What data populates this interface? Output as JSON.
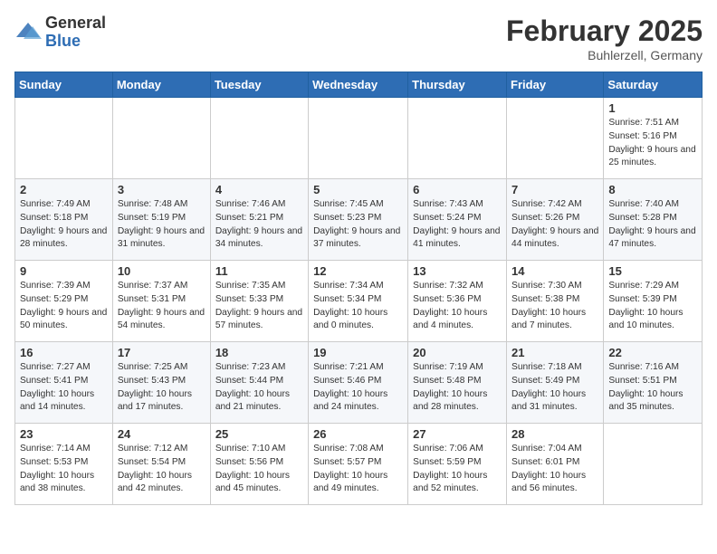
{
  "header": {
    "logo_general": "General",
    "logo_blue": "Blue",
    "month_title": "February 2025",
    "location": "Buhlerzell, Germany"
  },
  "weekdays": [
    "Sunday",
    "Monday",
    "Tuesday",
    "Wednesday",
    "Thursday",
    "Friday",
    "Saturday"
  ],
  "weeks": [
    [
      {
        "day": "",
        "info": ""
      },
      {
        "day": "",
        "info": ""
      },
      {
        "day": "",
        "info": ""
      },
      {
        "day": "",
        "info": ""
      },
      {
        "day": "",
        "info": ""
      },
      {
        "day": "",
        "info": ""
      },
      {
        "day": "1",
        "info": "Sunrise: 7:51 AM\nSunset: 5:16 PM\nDaylight: 9 hours and 25 minutes."
      }
    ],
    [
      {
        "day": "2",
        "info": "Sunrise: 7:49 AM\nSunset: 5:18 PM\nDaylight: 9 hours and 28 minutes."
      },
      {
        "day": "3",
        "info": "Sunrise: 7:48 AM\nSunset: 5:19 PM\nDaylight: 9 hours and 31 minutes."
      },
      {
        "day": "4",
        "info": "Sunrise: 7:46 AM\nSunset: 5:21 PM\nDaylight: 9 hours and 34 minutes."
      },
      {
        "day": "5",
        "info": "Sunrise: 7:45 AM\nSunset: 5:23 PM\nDaylight: 9 hours and 37 minutes."
      },
      {
        "day": "6",
        "info": "Sunrise: 7:43 AM\nSunset: 5:24 PM\nDaylight: 9 hours and 41 minutes."
      },
      {
        "day": "7",
        "info": "Sunrise: 7:42 AM\nSunset: 5:26 PM\nDaylight: 9 hours and 44 minutes."
      },
      {
        "day": "8",
        "info": "Sunrise: 7:40 AM\nSunset: 5:28 PM\nDaylight: 9 hours and 47 minutes."
      }
    ],
    [
      {
        "day": "9",
        "info": "Sunrise: 7:39 AM\nSunset: 5:29 PM\nDaylight: 9 hours and 50 minutes."
      },
      {
        "day": "10",
        "info": "Sunrise: 7:37 AM\nSunset: 5:31 PM\nDaylight: 9 hours and 54 minutes."
      },
      {
        "day": "11",
        "info": "Sunrise: 7:35 AM\nSunset: 5:33 PM\nDaylight: 9 hours and 57 minutes."
      },
      {
        "day": "12",
        "info": "Sunrise: 7:34 AM\nSunset: 5:34 PM\nDaylight: 10 hours and 0 minutes."
      },
      {
        "day": "13",
        "info": "Sunrise: 7:32 AM\nSunset: 5:36 PM\nDaylight: 10 hours and 4 minutes."
      },
      {
        "day": "14",
        "info": "Sunrise: 7:30 AM\nSunset: 5:38 PM\nDaylight: 10 hours and 7 minutes."
      },
      {
        "day": "15",
        "info": "Sunrise: 7:29 AM\nSunset: 5:39 PM\nDaylight: 10 hours and 10 minutes."
      }
    ],
    [
      {
        "day": "16",
        "info": "Sunrise: 7:27 AM\nSunset: 5:41 PM\nDaylight: 10 hours and 14 minutes."
      },
      {
        "day": "17",
        "info": "Sunrise: 7:25 AM\nSunset: 5:43 PM\nDaylight: 10 hours and 17 minutes."
      },
      {
        "day": "18",
        "info": "Sunrise: 7:23 AM\nSunset: 5:44 PM\nDaylight: 10 hours and 21 minutes."
      },
      {
        "day": "19",
        "info": "Sunrise: 7:21 AM\nSunset: 5:46 PM\nDaylight: 10 hours and 24 minutes."
      },
      {
        "day": "20",
        "info": "Sunrise: 7:19 AM\nSunset: 5:48 PM\nDaylight: 10 hours and 28 minutes."
      },
      {
        "day": "21",
        "info": "Sunrise: 7:18 AM\nSunset: 5:49 PM\nDaylight: 10 hours and 31 minutes."
      },
      {
        "day": "22",
        "info": "Sunrise: 7:16 AM\nSunset: 5:51 PM\nDaylight: 10 hours and 35 minutes."
      }
    ],
    [
      {
        "day": "23",
        "info": "Sunrise: 7:14 AM\nSunset: 5:53 PM\nDaylight: 10 hours and 38 minutes."
      },
      {
        "day": "24",
        "info": "Sunrise: 7:12 AM\nSunset: 5:54 PM\nDaylight: 10 hours and 42 minutes."
      },
      {
        "day": "25",
        "info": "Sunrise: 7:10 AM\nSunset: 5:56 PM\nDaylight: 10 hours and 45 minutes."
      },
      {
        "day": "26",
        "info": "Sunrise: 7:08 AM\nSunset: 5:57 PM\nDaylight: 10 hours and 49 minutes."
      },
      {
        "day": "27",
        "info": "Sunrise: 7:06 AM\nSunset: 5:59 PM\nDaylight: 10 hours and 52 minutes."
      },
      {
        "day": "28",
        "info": "Sunrise: 7:04 AM\nSunset: 6:01 PM\nDaylight: 10 hours and 56 minutes."
      },
      {
        "day": "",
        "info": ""
      }
    ]
  ]
}
